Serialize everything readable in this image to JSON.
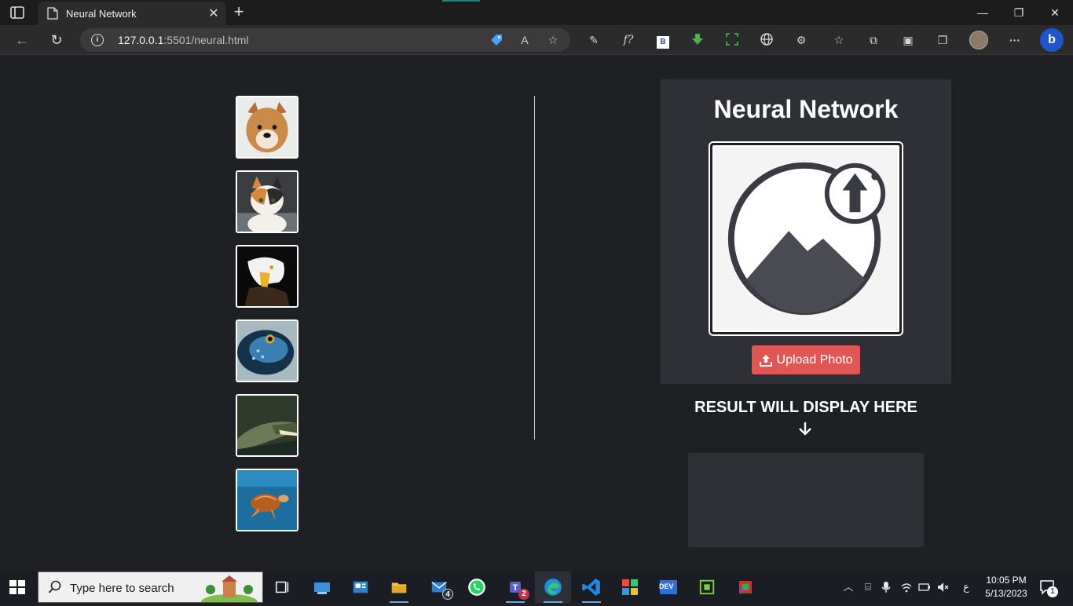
{
  "browser": {
    "tab_title": "Neural Network",
    "tab_close": "✕",
    "new_tab": "+",
    "url_host": "127.0.0.1",
    "url_rest": ":5501/neural.html",
    "info_glyph": "i",
    "window_controls": {
      "minimize": "—",
      "restore": "❐",
      "close": "✕"
    },
    "nav": {
      "back": "←",
      "refresh": "↻"
    },
    "toolbar_icons": [
      "tag-icon",
      "read-aloud-icon",
      "add-favorite-icon",
      "pen-extension-icon",
      "formula-extension-icon",
      "b-extension-icon",
      "download-extension-icon",
      "screenshot-extension-icon",
      "globe-icon",
      "extensions-icon",
      "favorites-icon",
      "collections-icon",
      "math-solver-icon",
      "tab-actions-icon",
      "profile-avatar",
      "more-icon",
      "bing-icon"
    ],
    "toolbar_glyphs": {
      "read_aloud": "A",
      "formula": "f?",
      "b_ext": "B",
      "more": "···",
      "bing": "b"
    }
  },
  "page": {
    "thumbnails": [
      {
        "name": "dog",
        "accent": "#c98a4a"
      },
      {
        "name": "cat",
        "accent": "#d9893b"
      },
      {
        "name": "eagle",
        "accent": "#e8b323"
      },
      {
        "name": "fish",
        "accent": "#3a7fb0"
      },
      {
        "name": "crocodile",
        "accent": "#4d5a3a"
      },
      {
        "name": "turtle",
        "accent": "#1d6e9e"
      }
    ],
    "card": {
      "title": "Neural Network",
      "upload_label": "Upload Photo"
    },
    "result": {
      "title": "RESULT WILL DISPLAY HERE"
    }
  },
  "colors": {
    "background": "#1f2023",
    "card": "#2e3036",
    "upload_button": "#e25555"
  },
  "taskbar": {
    "search_placeholder": "Type here to search",
    "apps": [
      "task-view-icon",
      "network-folder-icon",
      "news-icon",
      "file-explorer-icon",
      "mail-icon",
      "whatsapp-icon",
      "teams-icon",
      "edge-icon",
      "vscode-icon",
      "windows-app-icon",
      "dev-icon",
      "cpu-tool-icon",
      "settings-tool-icon"
    ],
    "mail_badge": "4",
    "teams_badge": "2",
    "dev_label": "DEV",
    "time": "10:05 PM",
    "date": "5/13/2023",
    "notification_count": "1",
    "language_glyph": "ع"
  }
}
